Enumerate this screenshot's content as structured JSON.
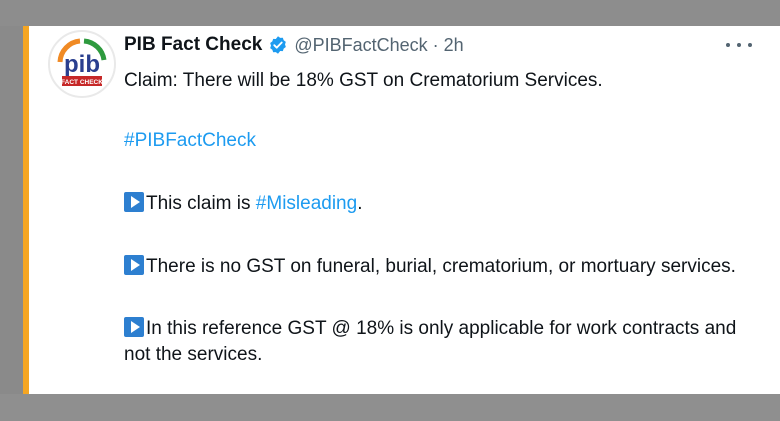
{
  "tweet": {
    "author_name": "PIB Fact Check",
    "handle": "@PIBFactCheck",
    "separator": "·",
    "time": "2h",
    "avatar_text": {
      "main": "pib",
      "sub": "FACT CHECK"
    },
    "claim": "Claim: There will be 18% GST on Crematorium Services.",
    "hashtag": "#PIBFactCheck",
    "point1": {
      "text": "This claim is ",
      "tag": "#Misleading",
      "after": "."
    },
    "point2": "There is no GST on funeral, burial, crematorium, or mortuary services.",
    "point3": "In this reference GST @ 18% is only applicable for work contracts and not the services."
  },
  "colors": {
    "accent_bar": "#f5a623",
    "link": "#1d9bf0",
    "verified": "#1d9bf0",
    "bullet": "#2d7fd0",
    "background_band": "#8c8c8c"
  },
  "icons": {
    "verified": "verified-badge-icon",
    "more": "more-options-icon",
    "bullet": "play-button-emoji-icon"
  }
}
